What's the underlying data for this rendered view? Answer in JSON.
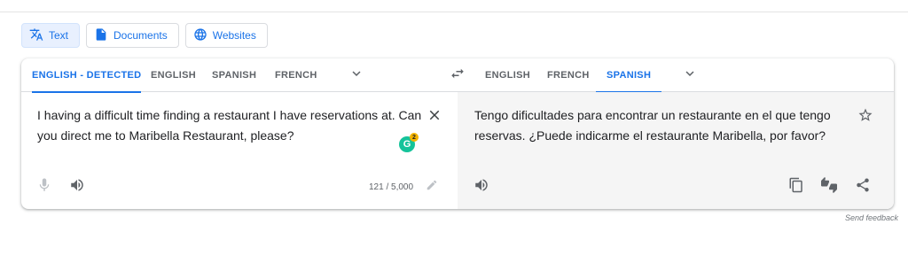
{
  "modes": [
    {
      "label": "Text",
      "icon": "translate-icon",
      "active": true
    },
    {
      "label": "Documents",
      "icon": "document-icon",
      "active": false
    },
    {
      "label": "Websites",
      "icon": "globe-icon",
      "active": false
    }
  ],
  "source_langs": [
    "ENGLISH - DETECTED",
    "ENGLISH",
    "SPANISH",
    "FRENCH"
  ],
  "target_langs": [
    "ENGLISH",
    "FRENCH",
    "SPANISH"
  ],
  "source": {
    "text": "I having a difficult time finding a restaurant I have reservations at. Can you direct me to Maribella Restaurant, please?",
    "char_count": "121 / 5,000",
    "grammarly_count": "2"
  },
  "target": {
    "text": "Tengo dificultades para encontrar un restaurante en el que tengo reservas. ¿Puede indicarme el restaurante Maribella, por favor?"
  },
  "footer": {
    "send_feedback": "Send feedback"
  },
  "colors": {
    "accent": "#1a73e8",
    "target_bg": "#f5f5f5"
  }
}
